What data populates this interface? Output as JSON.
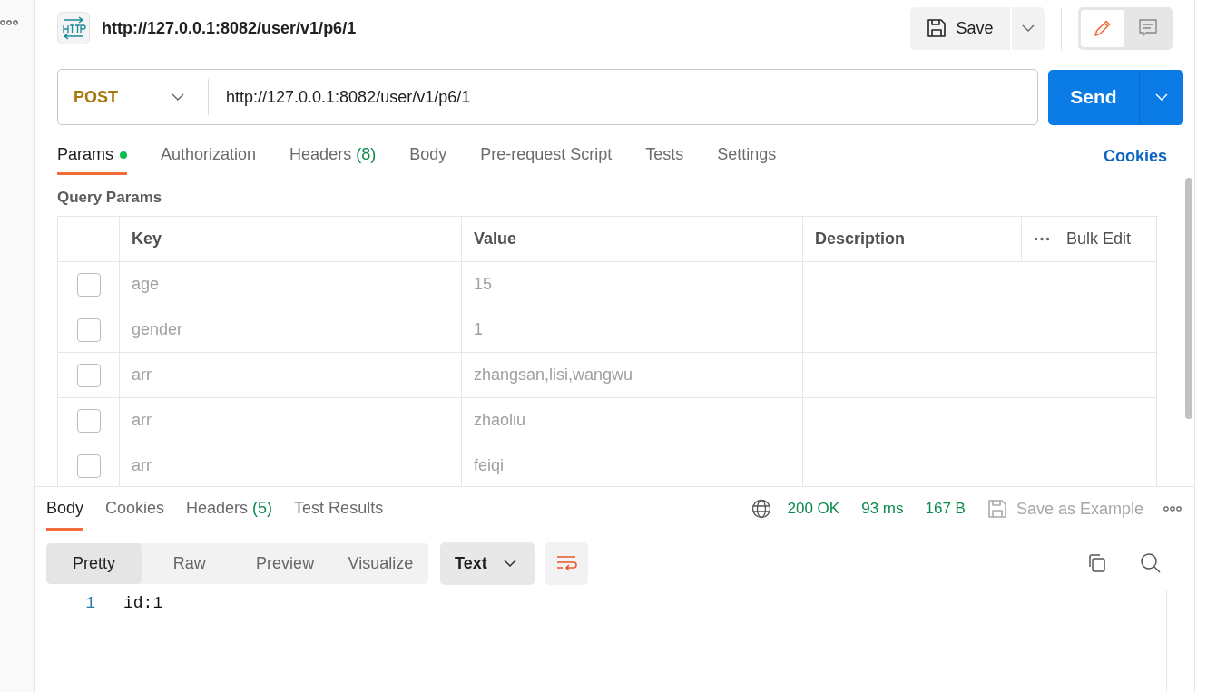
{
  "request": {
    "title": "http://127.0.0.1:8082/user/v1/p6/1",
    "save_label": "Save",
    "method": "POST",
    "url": "http://127.0.0.1:8082/user/v1/p6/1",
    "send_label": "Send"
  },
  "mode_toggle": [
    {
      "kind": "edit",
      "selected": true
    },
    {
      "kind": "comments",
      "selected": false
    }
  ],
  "request_tabs": [
    {
      "label": "Params",
      "indicator": true,
      "selected": true
    },
    {
      "label": "Authorization",
      "indicator": false,
      "selected": false
    },
    {
      "label": "Headers",
      "count": "(8)",
      "indicator": false,
      "selected": false
    },
    {
      "label": "Body",
      "indicator": false,
      "selected": false
    },
    {
      "label": "Pre-request Script",
      "indicator": false,
      "selected": false
    },
    {
      "label": "Tests",
      "indicator": false,
      "selected": false
    },
    {
      "label": "Settings",
      "indicator": false,
      "selected": false
    }
  ],
  "cookies_link": "Cookies",
  "query_params": {
    "title": "Query Params",
    "columns": [
      "Key",
      "Value",
      "Description"
    ],
    "bulk_edit": "Bulk Edit",
    "rows": [
      {
        "checked": false,
        "key": "age",
        "value": "15"
      },
      {
        "checked": false,
        "key": "gender",
        "value": "1"
      },
      {
        "checked": false,
        "key": "arr",
        "value": "zhangsan,lisi,wangwu"
      },
      {
        "checked": false,
        "key": "arr",
        "value": "zhaoliu"
      },
      {
        "checked": false,
        "key": "arr",
        "value": "feiqi"
      }
    ]
  },
  "response": {
    "tabs": [
      {
        "label": "Body",
        "selected": true
      },
      {
        "label": "Cookies",
        "selected": false
      },
      {
        "label": "Headers",
        "count": "(5)",
        "selected": false
      },
      {
        "label": "Test Results",
        "selected": false
      }
    ],
    "status": "200 OK",
    "time": "93 ms",
    "size": "167 B",
    "save_example": "Save as Example",
    "view_modes": [
      {
        "label": "Pretty",
        "selected": true
      },
      {
        "label": "Raw",
        "selected": false
      },
      {
        "label": "Preview",
        "selected": false
      },
      {
        "label": "Visualize",
        "selected": false
      }
    ],
    "format": "Text",
    "lines": [
      {
        "number": "1",
        "text": "id:1"
      }
    ]
  }
}
